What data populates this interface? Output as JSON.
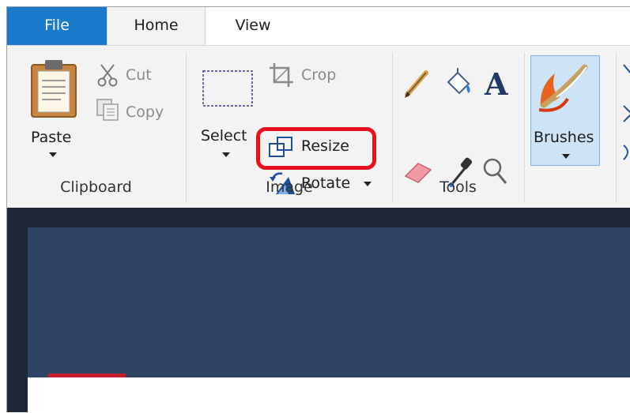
{
  "tabs": {
    "file": "File",
    "home": "Home",
    "view": "View"
  },
  "clipboard": {
    "paste": "Paste",
    "cut": "Cut",
    "copy": "Copy",
    "group_label": "Clipboard"
  },
  "image": {
    "select": "Select",
    "crop": "Crop",
    "resize": "Resize",
    "rotate": "Rotate",
    "group_label": "Image"
  },
  "tools": {
    "group_label": "Tools"
  },
  "brushes": {
    "label": "Brushes"
  },
  "colors": {
    "file_tab": "#1979ca",
    "highlight": "#e8101b",
    "canvas_bg": "#2e4466",
    "brushes_bg": "#cde4f7"
  }
}
